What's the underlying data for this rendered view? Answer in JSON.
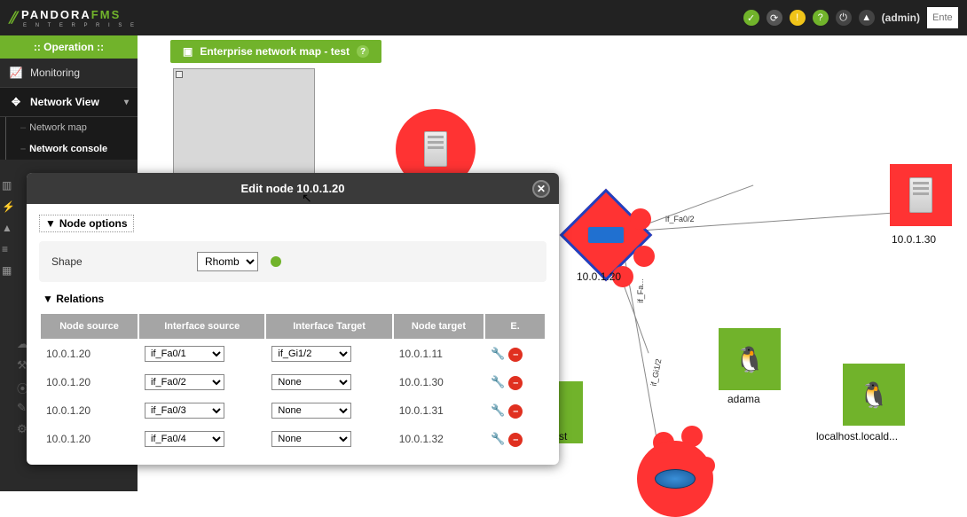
{
  "topbar": {
    "brand": "PANDORA",
    "brand2": "FMS",
    "sub": "E N T E R P R I S E",
    "user": "(admin)",
    "search_placeholder": "Enter k"
  },
  "sidebar": {
    "header": ":: Operation ::",
    "items": [
      {
        "label": "Monitoring"
      },
      {
        "label": "Network View"
      }
    ],
    "sub": [
      {
        "label": "Network map"
      },
      {
        "label": "Network console"
      }
    ]
  },
  "page": {
    "title": "Enterprise network map - test"
  },
  "nodes": {
    "router_label": "10.0.1.20",
    "server2_label": "10.0.1.30",
    "adama_label": "adama",
    "localhost_label": "localhost.locald...",
    "st_label": "st",
    "edge1": "if_Fa0/2",
    "edge2": "if_Fa...",
    "edge3": "if_Gi1/2"
  },
  "dialog": {
    "title": "Edit node 10.0.1.20",
    "node_options": "Node options",
    "shape_label": "Shape",
    "shape_value": "Rhomb",
    "relations": "Relations",
    "headers": {
      "c1": "Node source",
      "c2": "Interface source",
      "c3": "Interface Target",
      "c4": "Node target",
      "c5": "E."
    },
    "rows": [
      {
        "src": "10.0.1.20",
        "isrc": "if_Fa0/1",
        "itgt": "if_Gi1/2",
        "tgt": "10.0.1.11"
      },
      {
        "src": "10.0.1.20",
        "isrc": "if_Fa0/2",
        "itgt": "None",
        "tgt": "10.0.1.30"
      },
      {
        "src": "10.0.1.20",
        "isrc": "if_Fa0/3",
        "itgt": "None",
        "tgt": "10.0.1.31"
      },
      {
        "src": "10.0.1.20",
        "isrc": "if_Fa0/4",
        "itgt": "None",
        "tgt": "10.0.1.32"
      }
    ]
  }
}
